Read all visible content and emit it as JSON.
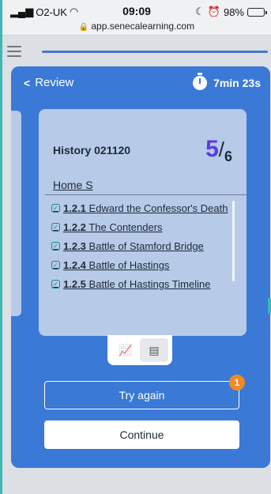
{
  "status": {
    "carrier": "O2-UK",
    "time": "09:09",
    "battery": "98%",
    "url": "app.senecalearning.com"
  },
  "modal": {
    "back_label": "Review",
    "timer": "7min 23s"
  },
  "card": {
    "title": "History 021120",
    "score_num": "5",
    "score_den": "6",
    "subtitle": "Home S",
    "topics": [
      {
        "code": "1.2.1",
        "label": "Edward the Confessor's Death"
      },
      {
        "code": "1.2.2",
        "label": "The Contenders"
      },
      {
        "code": "1.2.3",
        "label": "Battle of Stamford Bridge"
      },
      {
        "code": "1.2.4",
        "label": "Battle of Hastings"
      },
      {
        "code": "1.2.5",
        "label": "Battle of Hastings Timeline"
      }
    ]
  },
  "toggle": {
    "left_icon": "chart-icon",
    "right_icon": "document-icon"
  },
  "buttons": {
    "try_again": "Try again",
    "try_again_badge": "1",
    "continue": "Continue"
  },
  "colors": {
    "modal_bg": "#3a79d6",
    "card_bg": "#b7cae8",
    "score_accent": "#5a3ce6",
    "badge": "#f08a24"
  }
}
